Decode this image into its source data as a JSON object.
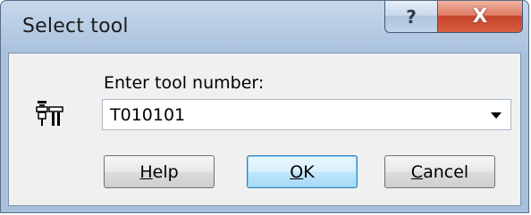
{
  "window": {
    "title": "Select tool",
    "help_button_label": "?",
    "close_button_label": "X"
  },
  "form": {
    "label": "Enter tool number:",
    "tool_number_value": "T010101",
    "icon": "tool-holders-icon"
  },
  "buttons": {
    "help": {
      "accel": "H",
      "rest": "elp"
    },
    "ok": {
      "accel": "O",
      "rest": "K"
    },
    "cancel": {
      "accel": "C",
      "rest": "ancel"
    }
  },
  "colors": {
    "titlebar": "#b8cde4",
    "close_button": "#c6442b",
    "client_bg": "#f0f0f0",
    "default_button": "#bee6fd"
  }
}
